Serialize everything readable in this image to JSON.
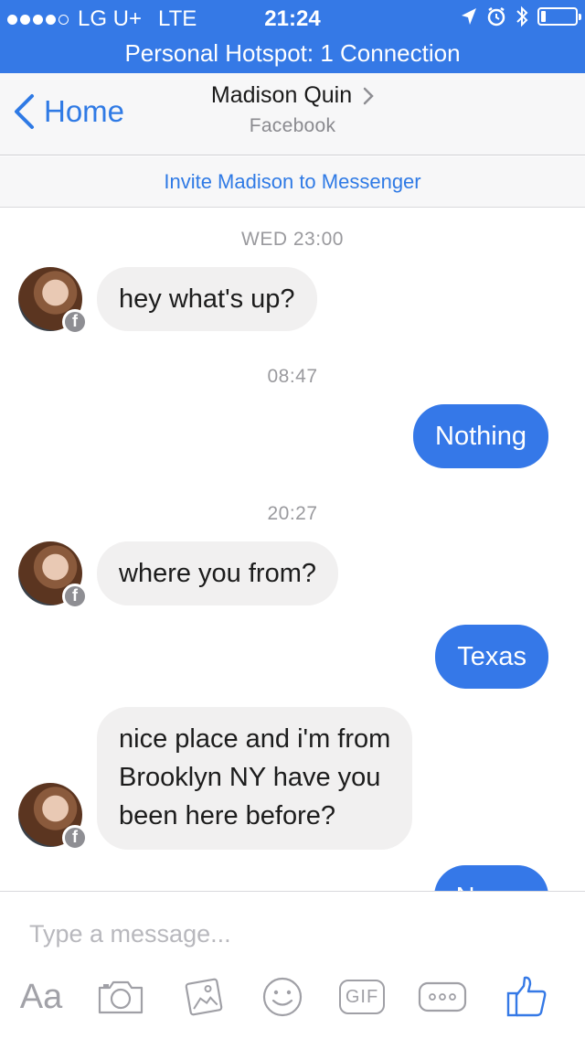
{
  "status_bar": {
    "carrier": "LG U+",
    "network": "LTE",
    "time": "21:24",
    "signal_dots": 5,
    "signal_filled": 4,
    "battery_level": 0.15
  },
  "hotspot": {
    "text": "Personal Hotspot: 1 Connection"
  },
  "nav": {
    "back_label": "Home",
    "title": "Madison Quin",
    "subtitle": "Facebook"
  },
  "invite": {
    "text": "Invite Madison to Messenger"
  },
  "messages": {
    "stamp1": "WED 23:00",
    "msg1": "hey what's up?",
    "stamp2": "08:47",
    "msg2": "Nothing",
    "stamp3": "20:27",
    "msg3": "where you from?",
    "msg4": "Texas",
    "msg5_line1": "nice place and i'm from",
    "msg5_line2": "Brooklyn NY have you",
    "msg5_line3": "been here before?",
    "msg6": "Never"
  },
  "composer": {
    "placeholder": "Type a message...",
    "aa_label": "Aa",
    "gif_label": "GIF"
  },
  "colors": {
    "accent": "#3579e6",
    "outgoing_bubble": "#3578e8",
    "incoming_bubble": "#f1f0f0",
    "muted": "#9a9a9e"
  },
  "icons": {
    "back": "chevron-left-icon",
    "title_chevron": "chevron-right-icon",
    "location": "location-arrow-icon",
    "alarm": "alarm-icon",
    "bluetooth": "bluetooth-icon",
    "camera": "camera-icon",
    "photos": "photos-icon",
    "emoji": "emoji-icon",
    "more": "more-icon",
    "like": "thumbs-up-icon"
  }
}
